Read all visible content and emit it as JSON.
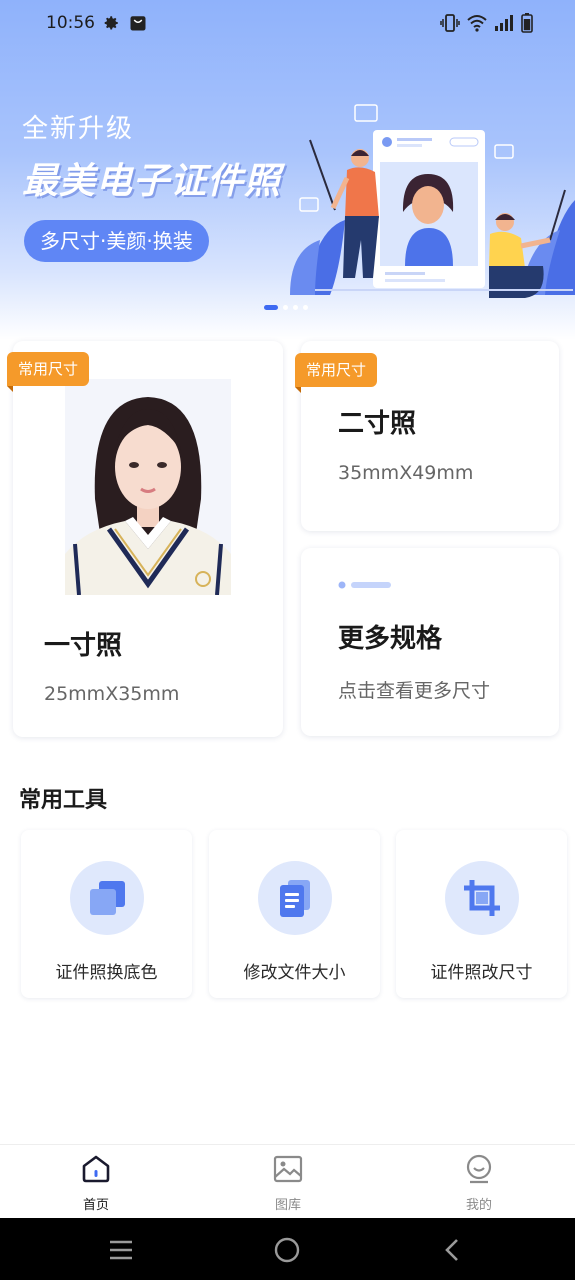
{
  "status_bar": {
    "time": "10:56",
    "left_icons": [
      "gear-icon",
      "bag-icon"
    ],
    "right_icons": [
      "vibrate-icon",
      "wifi-icon",
      "signal-icon",
      "battery-icon"
    ]
  },
  "banner": {
    "subtitle": "全新升级",
    "title": "最美电子证件照",
    "pill": "多尺寸·美颜·换装",
    "page_count": 4,
    "active_page": 1
  },
  "cards": {
    "one_inch": {
      "tag": "常用尺寸",
      "title": "一寸照",
      "size": "25mmX35mm"
    },
    "two_inch": {
      "tag": "常用尺寸",
      "title": "二寸照",
      "size": "35mmX49mm"
    },
    "more": {
      "title": "更多规格",
      "desc": "点击查看更多尺寸"
    }
  },
  "tools": {
    "title": "常用工具",
    "items": [
      {
        "label": "证件照换底色",
        "icon": "layers-icon"
      },
      {
        "label": "修改文件大小",
        "icon": "document-icon"
      },
      {
        "label": "证件照改尺寸",
        "icon": "crop-icon"
      }
    ]
  },
  "tabbar": {
    "items": [
      {
        "label": "首页",
        "icon": "home-icon",
        "active": true
      },
      {
        "label": "图库",
        "icon": "gallery-icon",
        "active": false
      },
      {
        "label": "我的",
        "icon": "profile-icon",
        "active": false
      }
    ]
  },
  "colors": {
    "accent": "#3e6af2",
    "tag": "#f59a2a",
    "pill": "#5f86f5",
    "tool_icon_bg": "#dfe8fc"
  }
}
